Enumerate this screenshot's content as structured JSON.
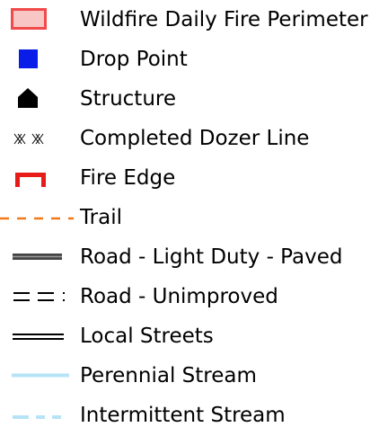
{
  "legend": {
    "items": [
      {
        "label": "Wildfire Daily Fire Perimeter",
        "symbol": "fire-perimeter-icon",
        "fill": "#f9c6c6",
        "stroke": "#f04a4a"
      },
      {
        "label": "Drop Point",
        "symbol": "drop-point-icon",
        "color": "#0a1de8"
      },
      {
        "label": "Structure",
        "symbol": "structure-icon",
        "color": "#000000"
      },
      {
        "label": "Completed Dozer Line",
        "symbol": "dozer-line-icon",
        "color": "#000000"
      },
      {
        "label": "Fire Edge",
        "symbol": "fire-edge-icon",
        "color": "#e81b1b"
      },
      {
        "label": "Trail",
        "symbol": "trail-icon",
        "color": "#f07a1a"
      },
      {
        "label": "Road - Light Duty - Paved",
        "symbol": "road-light-duty-paved-icon",
        "color": "#444444"
      },
      {
        "label": "Road - Unimproved",
        "symbol": "road-unimproved-icon",
        "color": "#000000"
      },
      {
        "label": "Local Streets",
        "symbol": "local-streets-icon",
        "color": "#000000"
      },
      {
        "label": "Perennial Stream",
        "symbol": "perennial-stream-icon",
        "color": "#b7e3f7"
      },
      {
        "label": "Intermittent Stream",
        "symbol": "intermittent-stream-icon",
        "color": "#b7e3f7"
      }
    ]
  }
}
